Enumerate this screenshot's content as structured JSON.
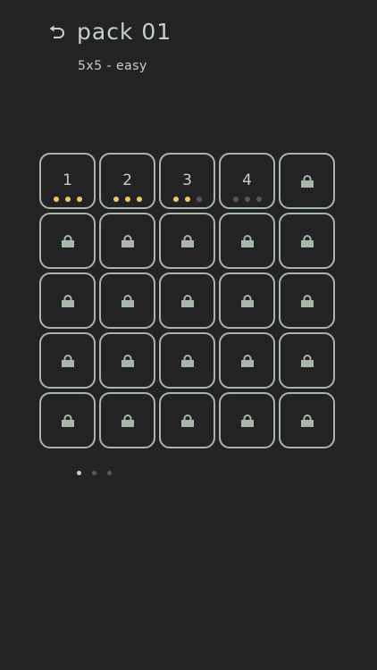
{
  "header": {
    "title": "pack 01",
    "subtitle": "5x5 - easy"
  },
  "levels": [
    {
      "label": "1",
      "locked": false,
      "stars": [
        true,
        true,
        true
      ]
    },
    {
      "label": "2",
      "locked": false,
      "stars": [
        true,
        true,
        true
      ]
    },
    {
      "label": "3",
      "locked": false,
      "stars": [
        true,
        true,
        false
      ]
    },
    {
      "label": "4",
      "locked": false,
      "stars": [
        false,
        false,
        false
      ]
    },
    {
      "label": "",
      "locked": true
    },
    {
      "label": "",
      "locked": true
    },
    {
      "label": "",
      "locked": true
    },
    {
      "label": "",
      "locked": true
    },
    {
      "label": "",
      "locked": true
    },
    {
      "label": "",
      "locked": true
    },
    {
      "label": "",
      "locked": true
    },
    {
      "label": "",
      "locked": true
    },
    {
      "label": "",
      "locked": true
    },
    {
      "label": "",
      "locked": true
    },
    {
      "label": "",
      "locked": true
    },
    {
      "label": "",
      "locked": true
    },
    {
      "label": "",
      "locked": true
    },
    {
      "label": "",
      "locked": true
    },
    {
      "label": "",
      "locked": true
    },
    {
      "label": "",
      "locked": true
    },
    {
      "label": "",
      "locked": true
    },
    {
      "label": "",
      "locked": true
    },
    {
      "label": "",
      "locked": true
    },
    {
      "label": "",
      "locked": true
    },
    {
      "label": "",
      "locked": true
    }
  ],
  "pager": {
    "pages": 3,
    "active": 0
  },
  "icons": {
    "back": "undo-arrow-icon",
    "locked": "lock-icon",
    "star_earned": "star-dot-earned",
    "star_empty": "star-dot-empty"
  },
  "colors": {
    "background": "#232325",
    "tile_border": "#a9b7ab",
    "text": "#c5d0c7",
    "star_earned": "#f1c76d",
    "star_empty": "#58585a"
  }
}
